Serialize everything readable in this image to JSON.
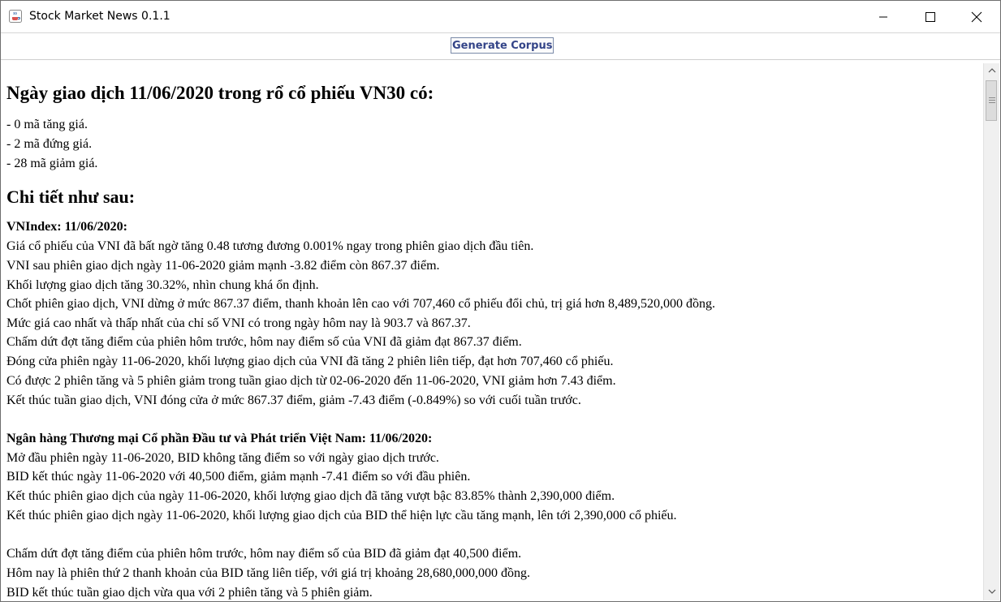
{
  "window": {
    "title": "Stock Market News 0.1.1",
    "icons": {
      "app": "java-cup-icon",
      "minimize": "minimize-icon",
      "maximize": "maximize-icon",
      "close": "close-icon"
    }
  },
  "toolbar": {
    "generate_label": "Generate Corpus"
  },
  "content": {
    "heading": "Ngày giao dịch 11/06/2020 trong rổ cổ phiếu VN30 có:",
    "summary": [
      "- 0 mã tăng giá.",
      "- 2 mã đứng giá.",
      "- 28 mã giảm giá."
    ],
    "details_heading": "Chi tiết như sau:",
    "sections": [
      {
        "title": "VNIndex: 11/06/2020:",
        "lines": [
          "Giá cổ phiếu của VNI đã bất ngờ tăng 0.48 tương đương 0.001% ngay trong phiên giao dịch đầu tiên.",
          "VNI sau phiên giao dịch ngày 11-06-2020 giảm mạnh -3.82 điểm còn 867.37 điểm.",
          "Khối lượng giao dịch tăng 30.32%, nhìn chung khá ổn định.",
          "Chốt phiên giao dịch, VNI dừng ở mức 867.37 điểm, thanh khoản lên cao với 707,460 cổ phiếu đổi chủ, trị giá hơn 8,489,520,000 đồng.",
          "Mức giá cao nhất và thấp nhất của chỉ số VNI có trong ngày hôm nay là 903.7 và 867.37.",
          "Chấm dứt đợt tăng điểm của phiên hôm trước, hôm nay điểm số của VNI đã giảm đạt 867.37 điểm.",
          "Đóng cửa phiên ngày 11-06-2020, khối lượng giao dịch của VNI đã tăng 2 phiên liên tiếp, đạt hơn 707,460 cổ phiếu.",
          "Có được 2 phiên tăng và 5 phiên giảm trong tuần giao dịch từ 02-06-2020 đến 11-06-2020, VNI giảm hơn 7.43 điểm.",
          "Kết thúc tuần giao dịch, VNI đóng cửa ở mức 867.37 điểm, giảm -7.43 điểm (-0.849%) so với cuối tuần trước."
        ]
      },
      {
        "title": "Ngân hàng Thương mại Cổ phần Đầu tư và Phát triển Việt Nam: 11/06/2020:",
        "lines": [
          "Mở đầu phiên ngày 11-06-2020, BID không tăng điểm so với ngày giao dịch trước.",
          "BID kết thúc ngày 11-06-2020 với 40,500 điểm, giảm mạnh -7.41 điểm so với đầu phiên.",
          "Kết thúc phiên giao dịch của ngày 11-06-2020, khối lượng giao dịch đã tăng vượt bậc 83.85% thành 2,390,000 điểm.",
          "Kết thúc phiên giao dịch ngày 11-06-2020, khối lượng giao dịch của BID thể hiện lực cầu tăng mạnh, lên tới 2,390,000 cổ phiếu.",
          "",
          "Chấm dứt đợt tăng điểm của phiên hôm trước, hôm nay điểm số của BID đã giảm đạt 40,500 điểm.",
          "Hôm nay là phiên thứ 2 thanh khoản của BID tăng liên tiếp, với giá trị khoảng 28,680,000,000 đồng.",
          "BID kết thúc tuần giao dịch vừa qua với 2 phiên tăng và 5 phiên giảm."
        ]
      }
    ]
  }
}
